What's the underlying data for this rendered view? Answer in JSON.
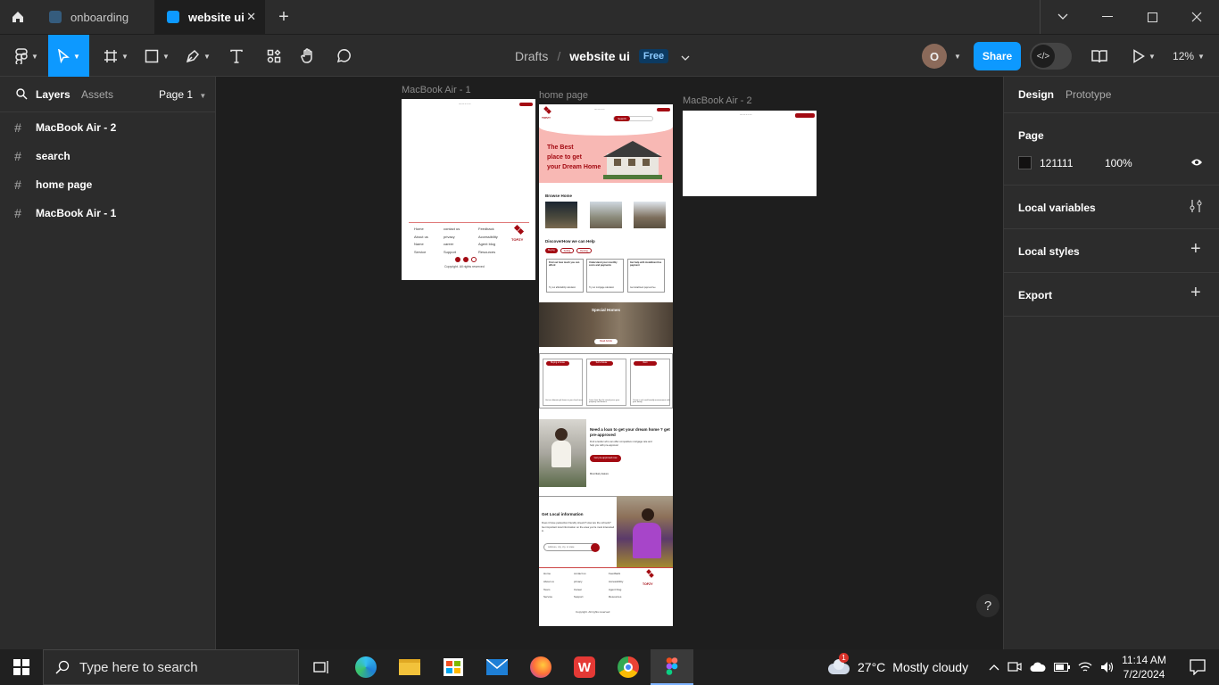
{
  "tabs": [
    {
      "label": "onboarding",
      "active": false
    },
    {
      "label": "website ui",
      "active": true
    }
  ],
  "breadcrumb": {
    "parent": "Drafts",
    "separator": "/",
    "file": "website ui",
    "plan_badge": "Free"
  },
  "toolbar": {
    "share_label": "Share",
    "zoom_label": "12%",
    "avatar_initial": "O"
  },
  "left_panel": {
    "tab_layers": "Layers",
    "tab_assets": "Assets",
    "page_select": "Page 1",
    "layers": [
      "MacBook Air - 2",
      "search",
      "home page",
      "MacBook Air - 1"
    ]
  },
  "right_panel": {
    "tab_design": "Design",
    "tab_prototype": "Prototype",
    "page_title": "Page",
    "page_color": "121111",
    "page_opacity": "100%",
    "sections": [
      "Local variables",
      "Local styles",
      "Export"
    ]
  },
  "canvas": {
    "frames": [
      {
        "label": "MacBook Air - 1"
      },
      {
        "label": "home page"
      },
      {
        "label": "MacBook Air - 2"
      }
    ],
    "home": {
      "brand": "TOPZY",
      "search_btn": "Search",
      "hero_line1": "The Best",
      "hero_line2": "place to get",
      "hero_line3": "your Dream Home",
      "browse_title": "Browse Home",
      "discover_title": "DiscoverHow we can Help",
      "pills": [
        "Buying",
        "Selling",
        "Renting"
      ],
      "cards": [
        {
          "title": "Find out how much you can afford",
          "link": "Try our affordability calculator"
        },
        {
          "title": "Understand your monthly costs and payments",
          "link": "Try our mortgage calculator"
        },
        {
          "title": "Get help with installment fee payment",
          "link": "Get installment payment fee"
        }
      ],
      "special_title": "Special Homes",
      "special_btn": "Read Article",
      "three_cards": [
        {
          "label": "Buying a house",
          "text": "Get an ultimate gift home in your local area"
        },
        {
          "label": "Sell a house",
          "text": "Learn how the the actual price your property and finance"
        },
        {
          "label": "Rent",
          "text": "Create a rich and friendly environment with your family"
        }
      ],
      "loan_title": "Need a loan to get your dream home ? get pre-approved",
      "loan_text": "Find a lender who can offer competitive mortgage rate and help you with pre-approval",
      "loan_btn": "Get pre-approved now",
      "loan_link": "Most likely feature",
      "local_title": "Get Local information",
      "local_text": "Does it have pedestrian friendly streets? How are the schools? Get important local information on the area you're most interested in.",
      "local_input": "Address, city, zip, or state",
      "footer_cols": [
        [
          "Home",
          "About us",
          "Team",
          "Service"
        ],
        [
          "contact us",
          "privacy",
          "Career",
          "Support"
        ],
        [
          "Feedback",
          "Accessibility",
          "Agent blog",
          "Resources"
        ]
      ],
      "copyright": "Copyright. All rights reserved"
    },
    "mac1": {
      "footer_cols": [
        [
          "Home",
          "About us",
          "Name",
          "Service"
        ],
        [
          "contact us",
          "privacy",
          "career",
          "Support"
        ],
        [
          "Feedback",
          "Accessibility",
          "Agent blog",
          "Resources"
        ]
      ],
      "brand": "TOPZY",
      "copyright": "Copyright. All rights reserved"
    }
  },
  "taskbar": {
    "search_placeholder": "Type here to search",
    "weather_temp": "27°C",
    "weather_text": "Mostly cloudy",
    "time": "11:14 AM",
    "date": "7/2/2024",
    "notification_badge": "1"
  },
  "colors": {
    "accent_blue": "#0d99ff",
    "brand_red": "#a30a12",
    "panel": "#2c2c2c",
    "canvas": "#1e1e1e"
  }
}
